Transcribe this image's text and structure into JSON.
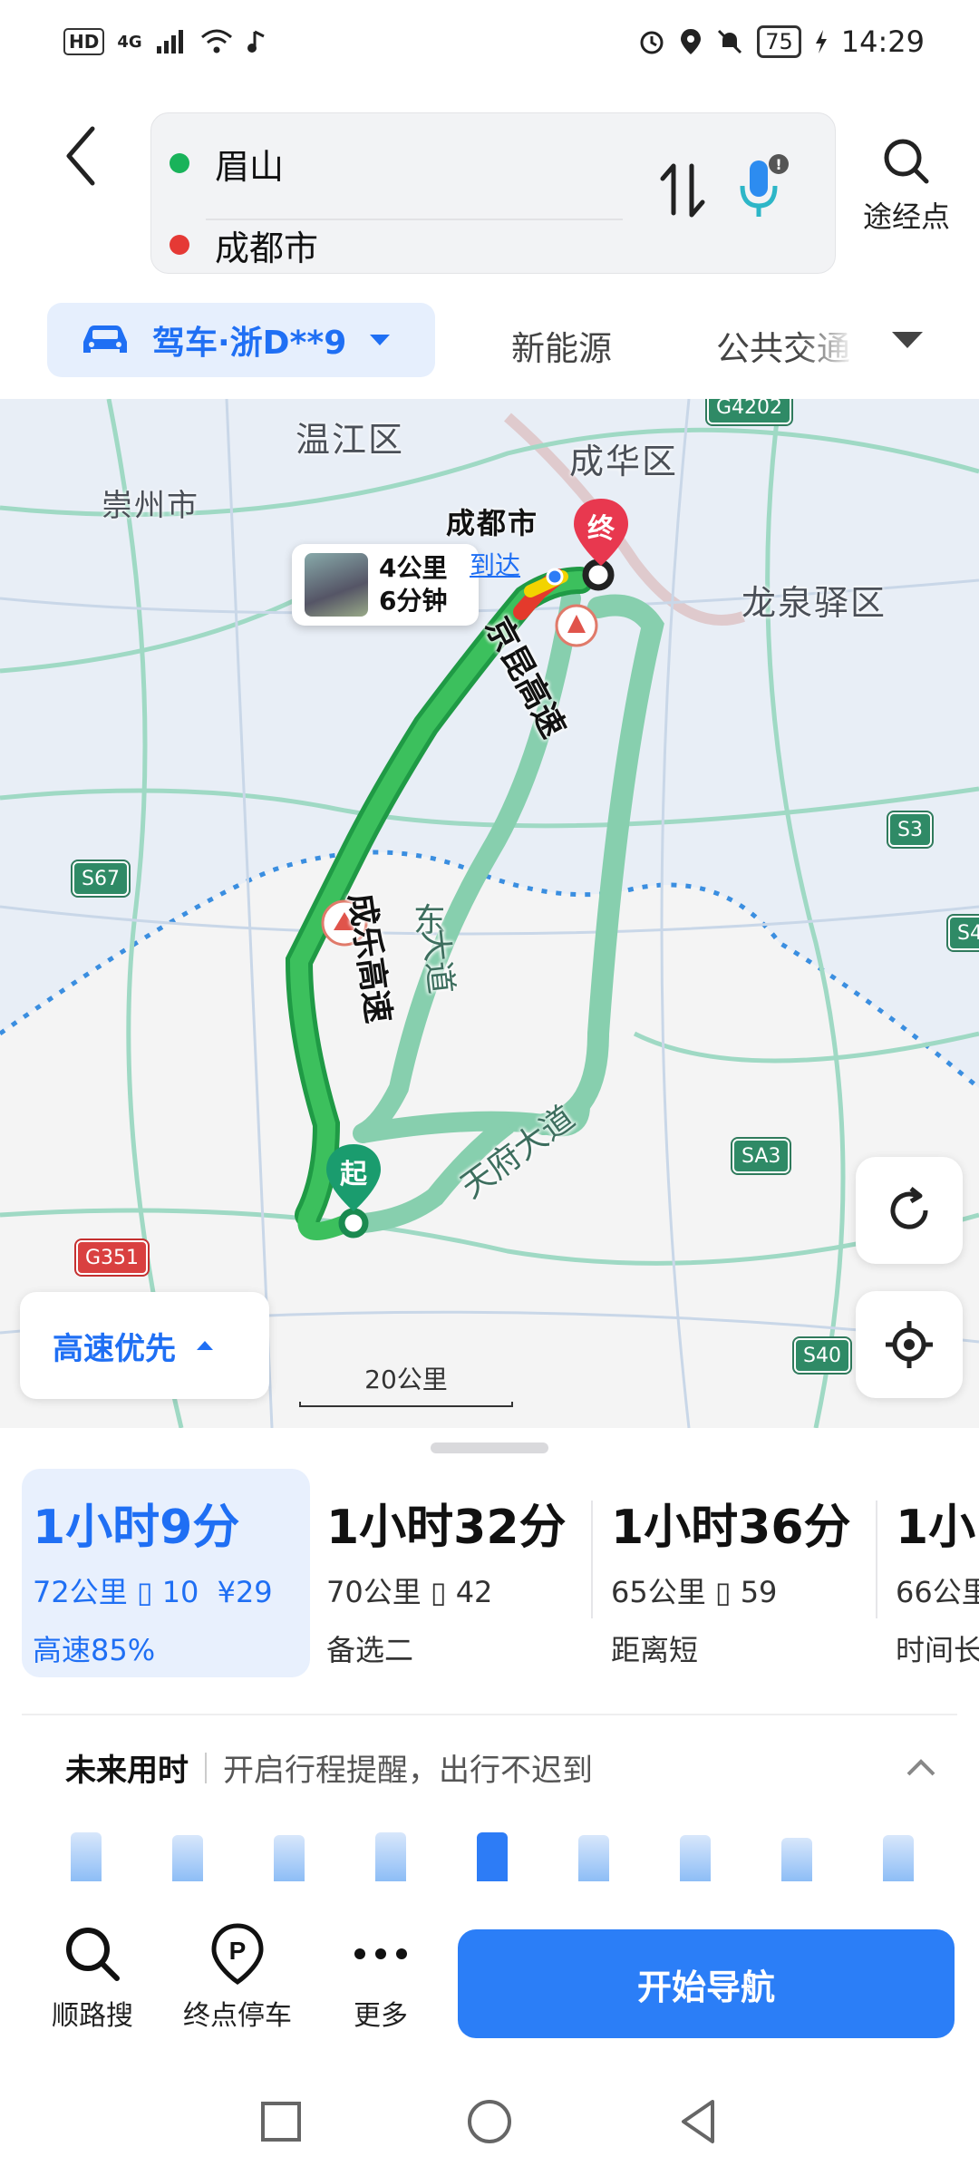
{
  "status_bar": {
    "network_badge": "HD",
    "network_type": "4G",
    "battery": "75",
    "time": "14:29"
  },
  "search": {
    "origin": "眉山",
    "destination": "成都市",
    "waypoint_label": "途经点",
    "origin_color": "#19b35a",
    "destination_color": "#e53935"
  },
  "modes": {
    "drive": "驾车·浙D**9",
    "new_energy": "新能源",
    "transit": "公共交通"
  },
  "map": {
    "district_labels": [
      "温江区",
      "成华区",
      "崇州市",
      "龙泉驿区"
    ],
    "city_label": "成都市",
    "roads": {
      "main_1": "京昆高速",
      "main_2": "成乐高速",
      "alt_1": "天府大道",
      "alt_2_a": "东",
      "alt_2_b": "大道"
    },
    "shields": [
      "S67",
      "S3",
      "SA3",
      "G351",
      "S40",
      "S4",
      "G4202"
    ],
    "traffic_card": {
      "distance": "4公里",
      "duration": "6分钟"
    },
    "arrive": "到达",
    "start_pin": "起",
    "end_pin": "终",
    "route_preference": "高速优先",
    "scale": "20公里",
    "route_color": "#22a348",
    "alt_route_color": "#87cfae"
  },
  "routes": [
    {
      "time": "1小时9分",
      "distance": "72公里",
      "lights": "10",
      "toll": "¥29",
      "tag": "高速85%"
    },
    {
      "time": "1小时32分",
      "distance": "70公里",
      "lights": "42",
      "toll": "",
      "tag": "备选二"
    },
    {
      "time": "1小时36分",
      "distance": "65公里",
      "lights": "59",
      "toll": "",
      "tag": "距离短"
    },
    {
      "time": "1小",
      "distance": "66公里",
      "lights": "",
      "toll": "",
      "tag": "时间长"
    }
  ],
  "future": {
    "title": "未来用时",
    "hint": "开启行程提醒，出行不迟到",
    "bar_levels": [
      0.72,
      0.68,
      0.68,
      0.72,
      0.72,
      0.68,
      0.68,
      0.64,
      0.68
    ],
    "current_index": 4
  },
  "actions": {
    "search_along": "顺路搜",
    "parking": "终点停车",
    "more": "更多",
    "start_nav": "开始导航"
  },
  "colors": {
    "accent": "#1f6ff4",
    "nav_button": "#2b7ef7"
  }
}
